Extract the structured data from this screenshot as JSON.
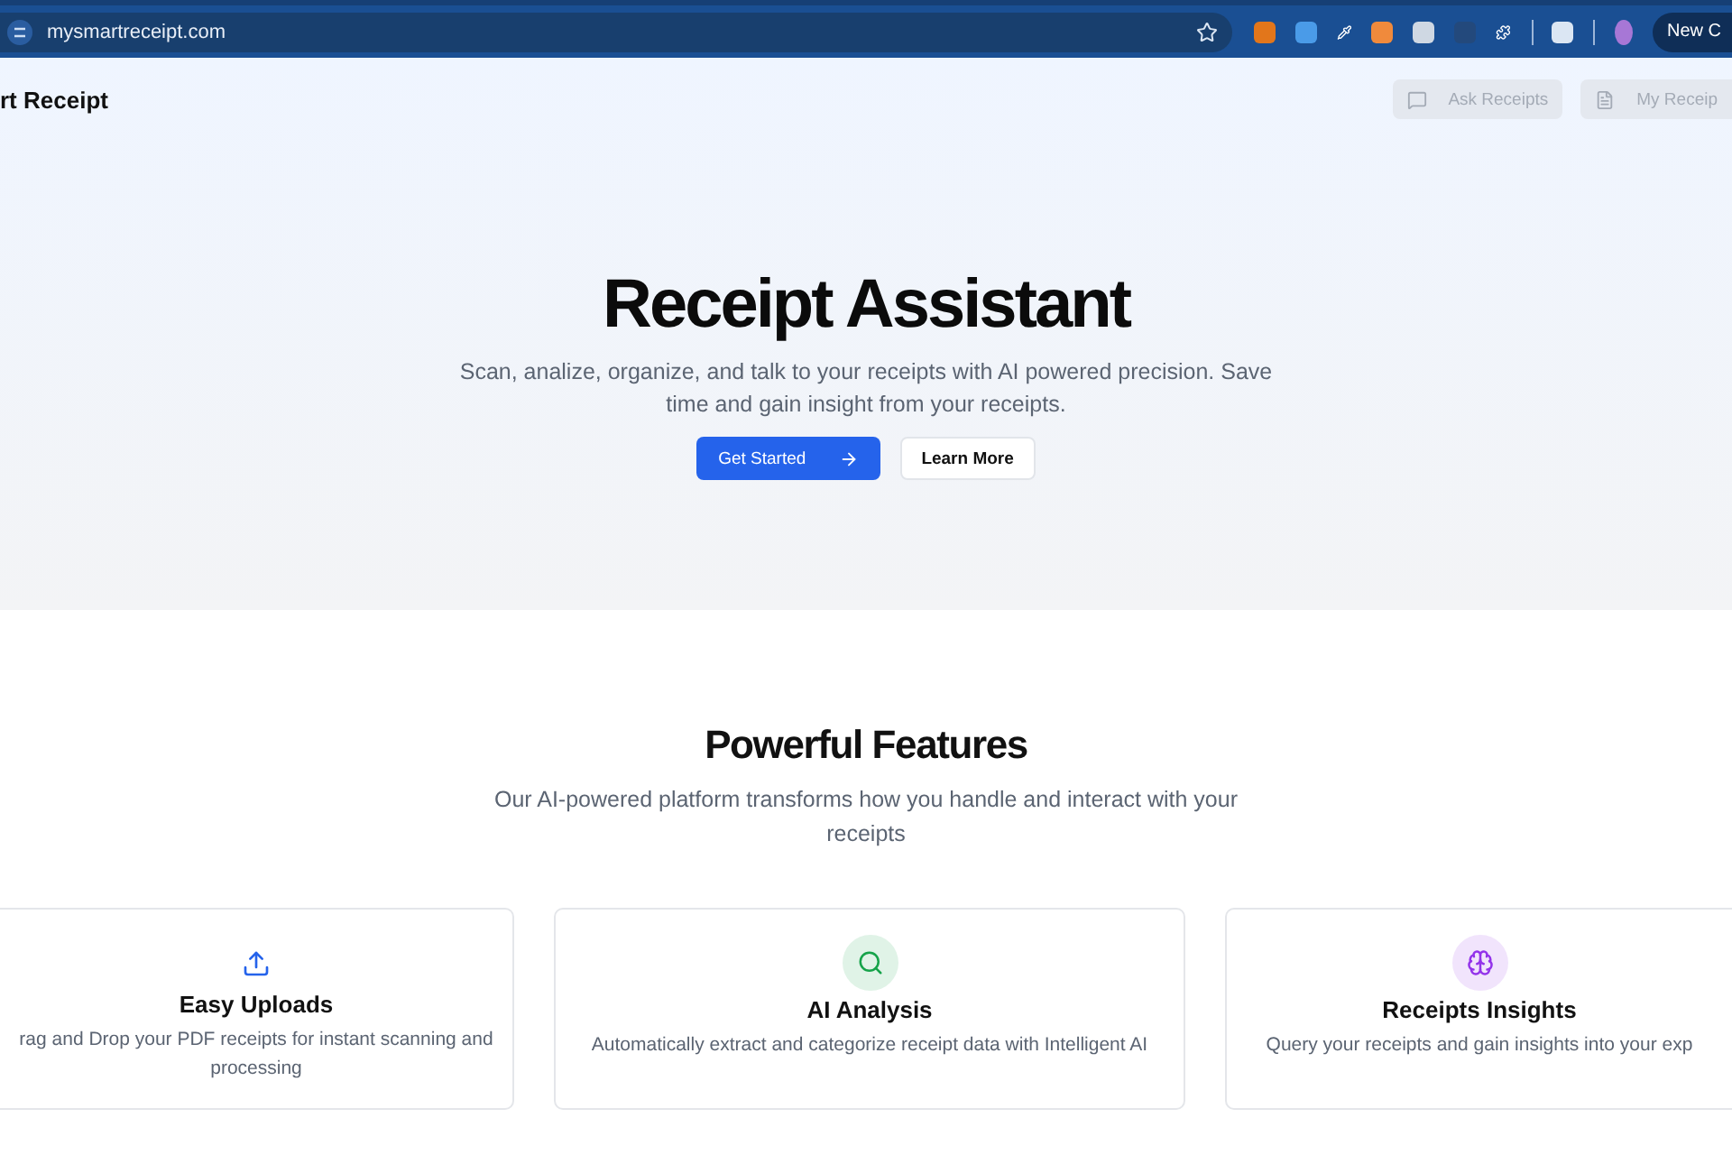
{
  "browser": {
    "url": "mysmartreceipt.com",
    "profile_button": "New C"
  },
  "nav": {
    "brand": "rt Receipt",
    "buttons": [
      {
        "kind": "chat",
        "label": "Ask Receipts"
      },
      {
        "kind": "file",
        "label": "My Receip"
      }
    ]
  },
  "hero": {
    "title": "Receipt Assistant",
    "subtitle": "Scan, analize, organize, and talk to your receipts with AI powered precision. Save time and gain insight from your receipts.",
    "primary_button": "Get Started",
    "secondary_button": "Learn More"
  },
  "features": {
    "title": "Powerful Features",
    "subtitle": "Our AI-powered platform transforms how you handle and interact with your receipts",
    "cards": [
      {
        "kind": "upload",
        "color": "#2563eb",
        "title": "Easy Uploads",
        "text": "rag and Drop your PDF receipts for instant scanning and processing"
      },
      {
        "kind": "search",
        "color": "#16a34a",
        "title": "AI Analysis",
        "text": "Automatically extract and categorize receipt data with Intelligent AI"
      },
      {
        "kind": "brain",
        "color": "#9333ea",
        "title": "Receipts Insights",
        "text": "Query your receipts and gain insights into your exp"
      }
    ]
  }
}
